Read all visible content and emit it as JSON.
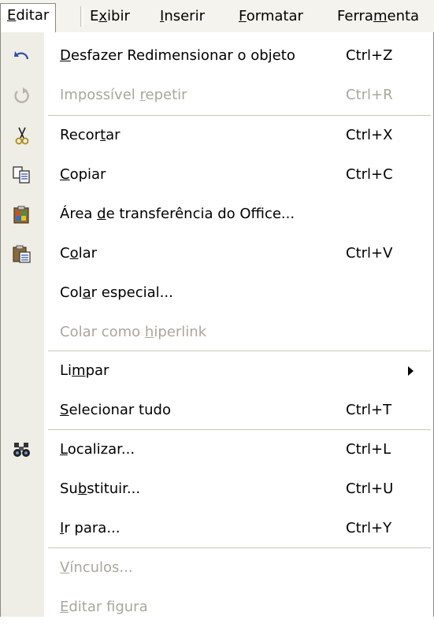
{
  "menubar": {
    "items": [
      {
        "pre": "",
        "u": "E",
        "post": "ditar"
      },
      {
        "pre": "E",
        "u": "x",
        "post": "ibir"
      },
      {
        "pre": "",
        "u": "I",
        "post": "nserir"
      },
      {
        "pre": "",
        "u": "F",
        "post": "ormatar"
      },
      {
        "pre": "Ferra",
        "u": "m",
        "post": "enta"
      }
    ]
  },
  "menu": {
    "items": [
      {
        "pre": "",
        "u": "D",
        "post": "esfazer Redimensionar o objeto",
        "shortcut": "Ctrl+Z",
        "icon": "undo-icon"
      },
      {
        "pre": "Impossível ",
        "u": "r",
        "post": "epetir",
        "shortcut": "Ctrl+R",
        "icon": "redo-icon"
      },
      {
        "pre": "Recor",
        "u": "t",
        "post": "ar",
        "shortcut": "Ctrl+X",
        "icon": "scissors-icon"
      },
      {
        "pre": "",
        "u": "C",
        "post": "opiar",
        "shortcut": "Ctrl+C",
        "icon": "copy-icon"
      },
      {
        "pre": "Área ",
        "u": "d",
        "post": "e transferência do Office...",
        "shortcut": "",
        "icon": "clipboard-icon"
      },
      {
        "pre": "C",
        "u": "o",
        "post": "lar",
        "shortcut": "Ctrl+V",
        "icon": "paste-icon"
      },
      {
        "pre": "Col",
        "u": "a",
        "post": "r especial...",
        "shortcut": "",
        "icon": ""
      },
      {
        "pre": "Colar como ",
        "u": "h",
        "post": "iperlink",
        "shortcut": "",
        "icon": ""
      },
      {
        "pre": "Li",
        "u": "m",
        "post": "par",
        "shortcut": "",
        "icon": ""
      },
      {
        "pre": "",
        "u": "S",
        "post": "elecionar tudo",
        "shortcut": "Ctrl+T",
        "icon": ""
      },
      {
        "pre": "",
        "u": "L",
        "post": "ocalizar...",
        "shortcut": "Ctrl+L",
        "icon": "binoculars-icon"
      },
      {
        "pre": "Su",
        "u": "b",
        "post": "stituir...",
        "shortcut": "Ctrl+U",
        "icon": ""
      },
      {
        "pre": "",
        "u": "I",
        "post": "r para...",
        "shortcut": "Ctrl+Y",
        "icon": ""
      },
      {
        "pre": "",
        "u": "V",
        "post": "ínculos...",
        "shortcut": "",
        "icon": ""
      },
      {
        "pre": "",
        "u": "E",
        "post": "ditar figura",
        "shortcut": "",
        "icon": ""
      }
    ]
  }
}
